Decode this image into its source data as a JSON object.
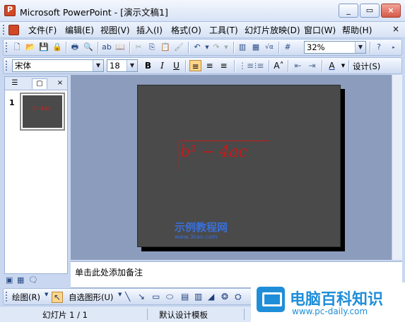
{
  "window": {
    "title": "Microsoft PowerPoint - [演示文稿1]"
  },
  "menu": [
    "文件(F)",
    "编辑(E)",
    "视图(V)",
    "插入(I)",
    "格式(O)",
    "工具(T)",
    "幻灯片放映(D)",
    "窗口(W)",
    "帮助(H)"
  ],
  "menu_close": "×",
  "standard_toolbar": {
    "zoom": "32%"
  },
  "formatting_toolbar": {
    "font": "宋体",
    "font_size": "18",
    "bold": "B",
    "italic": "I",
    "underline": "U",
    "design_label": "设计(S)"
  },
  "outline_pane": {
    "slide_number": "1",
    "thumb_text": "b²-4ac"
  },
  "slide": {
    "formula": "b² − 4ac"
  },
  "notes": {
    "placeholder": "单击此处添加备注"
  },
  "drawing_toolbar": {
    "draw_label": "绘图(R)",
    "autoshapes_label": "自选图形(U)"
  },
  "status": {
    "slide_indicator": "幻灯片 1 / 1",
    "design": "默认设计模板"
  },
  "watermarks": {
    "center_text": "示例教程网",
    "center_sub": "www.3lian.com",
    "brand_title": "电脑百科知识",
    "brand_url": "www.pc-daily.com"
  },
  "colors": {
    "formula": "#c71a1a",
    "slide_bg": "#4a4a4a",
    "brand": "#1f8ed8"
  }
}
